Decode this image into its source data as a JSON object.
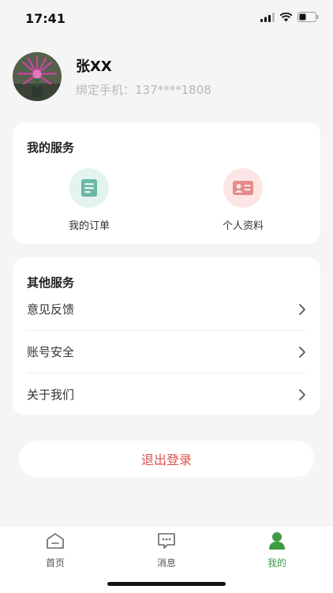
{
  "status_bar": {
    "time": "17:41"
  },
  "profile": {
    "name": "张XX",
    "phone": "绑定手机：137****1808"
  },
  "my_services": {
    "title": "我的服务",
    "items": [
      {
        "label": "我的订单",
        "icon": "order-list-icon",
        "color": "#6ab7a3"
      },
      {
        "label": "个人资料",
        "icon": "id-card-icon",
        "color": "#e68a8a"
      }
    ]
  },
  "other_services": {
    "title": "其他服务",
    "items": [
      {
        "label": "意见反馈",
        "icon": "chevron-right-icon"
      },
      {
        "label": "账号安全",
        "icon": "chevron-right-icon"
      },
      {
        "label": "关于我们",
        "icon": "chevron-right-icon"
      }
    ]
  },
  "logout": {
    "label": "退出登录",
    "color": "#d9534f"
  },
  "tabbar": {
    "accent": "#3d9b42",
    "items": [
      {
        "label": "首页",
        "icon": "home-icon"
      },
      {
        "label": "消息",
        "icon": "message-icon"
      },
      {
        "label": "我的",
        "icon": "user-icon",
        "active": true
      }
    ]
  }
}
